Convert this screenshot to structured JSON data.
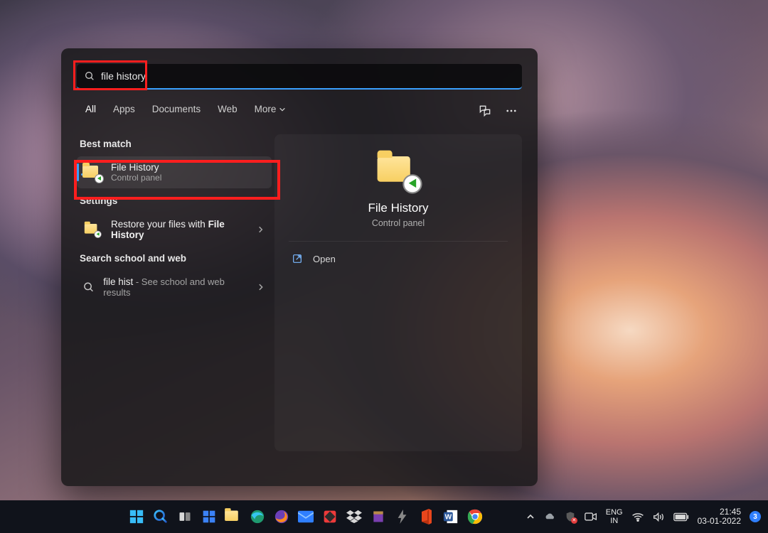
{
  "search": {
    "value": "file history"
  },
  "tabs": [
    "All",
    "Apps",
    "Documents",
    "Web",
    "More"
  ],
  "active_tab": 0,
  "groups": {
    "best_match": {
      "label": "Best match",
      "item": {
        "title": "File History",
        "subtitle": "Control panel"
      }
    },
    "settings": {
      "label": "Settings",
      "item": {
        "prefix": "Restore your files with ",
        "bold": "File History"
      }
    },
    "web": {
      "label": "Search school and web",
      "item": {
        "term": "file hist",
        "suffix": " - See school and web results"
      }
    }
  },
  "detail": {
    "title": "File History",
    "subtitle": "Control panel",
    "action": "Open"
  },
  "taskbar": {
    "lang_top": "ENG",
    "lang_bot": "IN",
    "time": "21:45",
    "date": "03-01-2022",
    "notif_count": "3"
  }
}
